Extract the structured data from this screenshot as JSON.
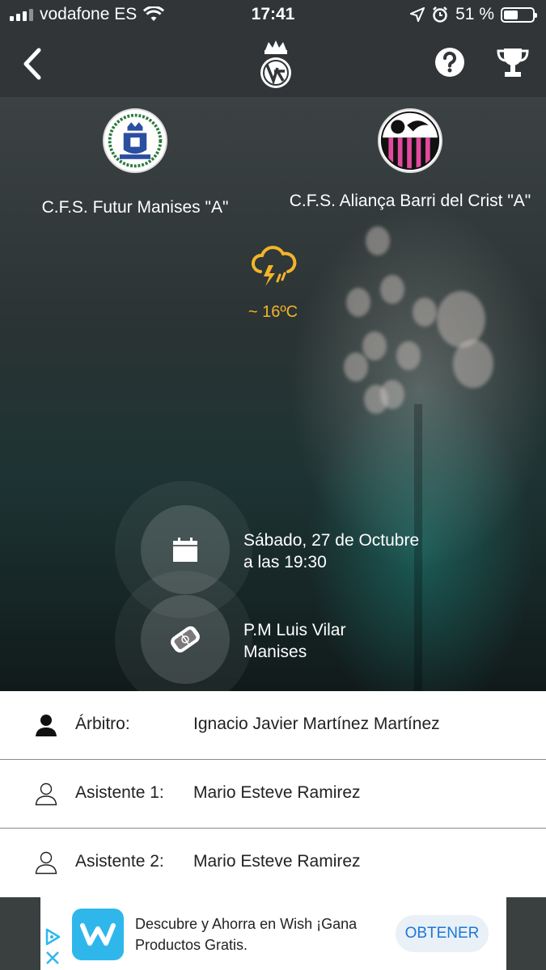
{
  "status_bar": {
    "carrier": "vodafone ES",
    "time": "17:41",
    "battery": "51 %",
    "battery_level": 0.51
  },
  "nav": {
    "icons": [
      "back-arrow-icon",
      "federation-logo",
      "help-icon",
      "trophy-icon"
    ]
  },
  "match": {
    "home_team": "C.F.S. Futur Manises \"A\"",
    "away_team": "C.F.S. Aliança Barri del Crist \"A\"",
    "weather": {
      "icon": "thunderstorm-cloud-icon",
      "temperature": "~ 16ºC",
      "color": "#f3b429"
    },
    "date_line1": "Sábado, 27 de Octubre",
    "date_line2": "a las 19:30",
    "venue_line1": "P.M Luis Vilar",
    "venue_line2": "Manises"
  },
  "officials": [
    {
      "role": "Árbitro:",
      "name": "Ignacio Javier Martínez Martínez",
      "icon": "person-filled-icon"
    },
    {
      "role": "Asistente 1:",
      "name": "Mario Esteve Ramirez",
      "icon": "person-outline-icon"
    },
    {
      "role": "Asistente 2:",
      "name": "Mario Esteve Ramirez",
      "icon": "person-outline-icon"
    }
  ],
  "ad": {
    "text": "Descubre y Ahorra en Wish ¡Gana Productos Gratis.",
    "cta": "OBTENER",
    "brand_color": "#2fb7ec"
  }
}
